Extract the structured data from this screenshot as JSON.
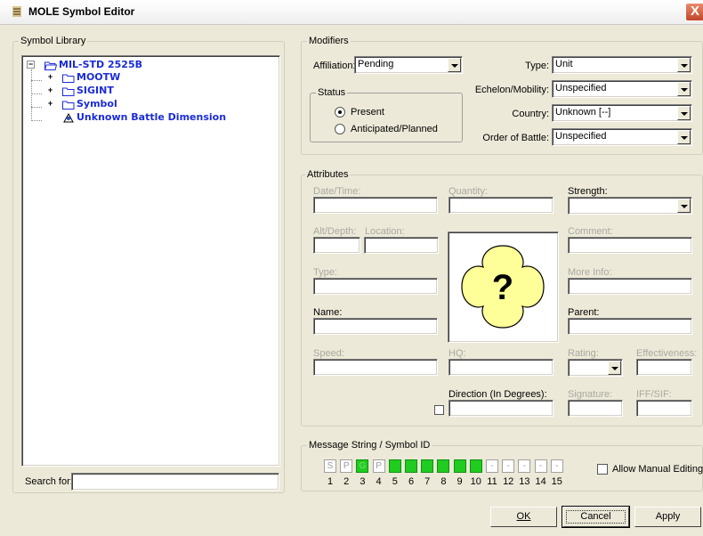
{
  "window": {
    "title": "MOLE Symbol Editor",
    "close_glyph": "X"
  },
  "library": {
    "legend": "Symbol Library",
    "tree": [
      {
        "label": "MIL-STD 2525B",
        "expander": "−",
        "icon": "open-folder-icon"
      },
      {
        "label": "MOOTW",
        "expander": "+",
        "icon": "folder-icon"
      },
      {
        "label": "SIGINT",
        "expander": "+",
        "icon": "folder-icon"
      },
      {
        "label": "Symbol",
        "expander": "+",
        "icon": "folder-icon"
      },
      {
        "label": "Unknown Battle Dimension",
        "icon": "symbol-icon"
      }
    ],
    "search_label": "Search for:",
    "search_value": ""
  },
  "modifiers": {
    "legend": "Modifiers",
    "affiliation_label": "Affiliation:",
    "affiliation_value": "Pending",
    "status_legend": "Status",
    "status_options": [
      "Present",
      "Anticipated/Planned"
    ],
    "status_selected": "Present",
    "type_label": "Type:",
    "type_value": "Unit",
    "echelon_label": "Echelon/Mobility:",
    "echelon_value": "Unspecified",
    "country_label": "Country:",
    "country_value": "Unknown [--]",
    "order_label": "Order of Battle:",
    "order_value": "Unspecified"
  },
  "attributes": {
    "legend": "Attributes",
    "date_time": "Date/Time:",
    "quantity": "Quantity:",
    "strength": "Strength:",
    "alt_depth": "Alt/Depth:",
    "location": "Location:",
    "comment": "Comment:",
    "type": "Type:",
    "more_info": "More Info:",
    "name": "Name:",
    "parent": "Parent:",
    "speed": "Speed:",
    "hq": "HQ:",
    "rating": "Rating:",
    "effectiveness": "Effectiveness:",
    "direction": "Direction (In Degrees):",
    "signature": "Signature:",
    "iff_sif": "IFF/SIF:",
    "symbol_glyph": "?",
    "symbol_color": "#ffff99"
  },
  "message": {
    "legend": "Message String / Symbol ID",
    "chars": [
      "S",
      "P",
      "G",
      "P",
      "",
      "",
      "",
      "",
      "",
      "",
      "-",
      "-",
      "-",
      "-",
      "-"
    ],
    "highlighted": [
      false,
      false,
      true,
      false,
      true,
      true,
      true,
      true,
      true,
      true,
      false,
      false,
      false,
      false,
      false
    ],
    "numbers": [
      "1",
      "2",
      "3",
      "4",
      "5",
      "6",
      "7",
      "8",
      "9",
      "10",
      "11",
      "12",
      "13",
      "14",
      "15"
    ],
    "allow_manual_label": "Allow Manual Editing",
    "allow_manual_checked": false,
    "highlight_color": "#1fcc1f"
  },
  "buttons": {
    "ok": "OK",
    "cancel": "Cancel",
    "apply": "Apply"
  }
}
